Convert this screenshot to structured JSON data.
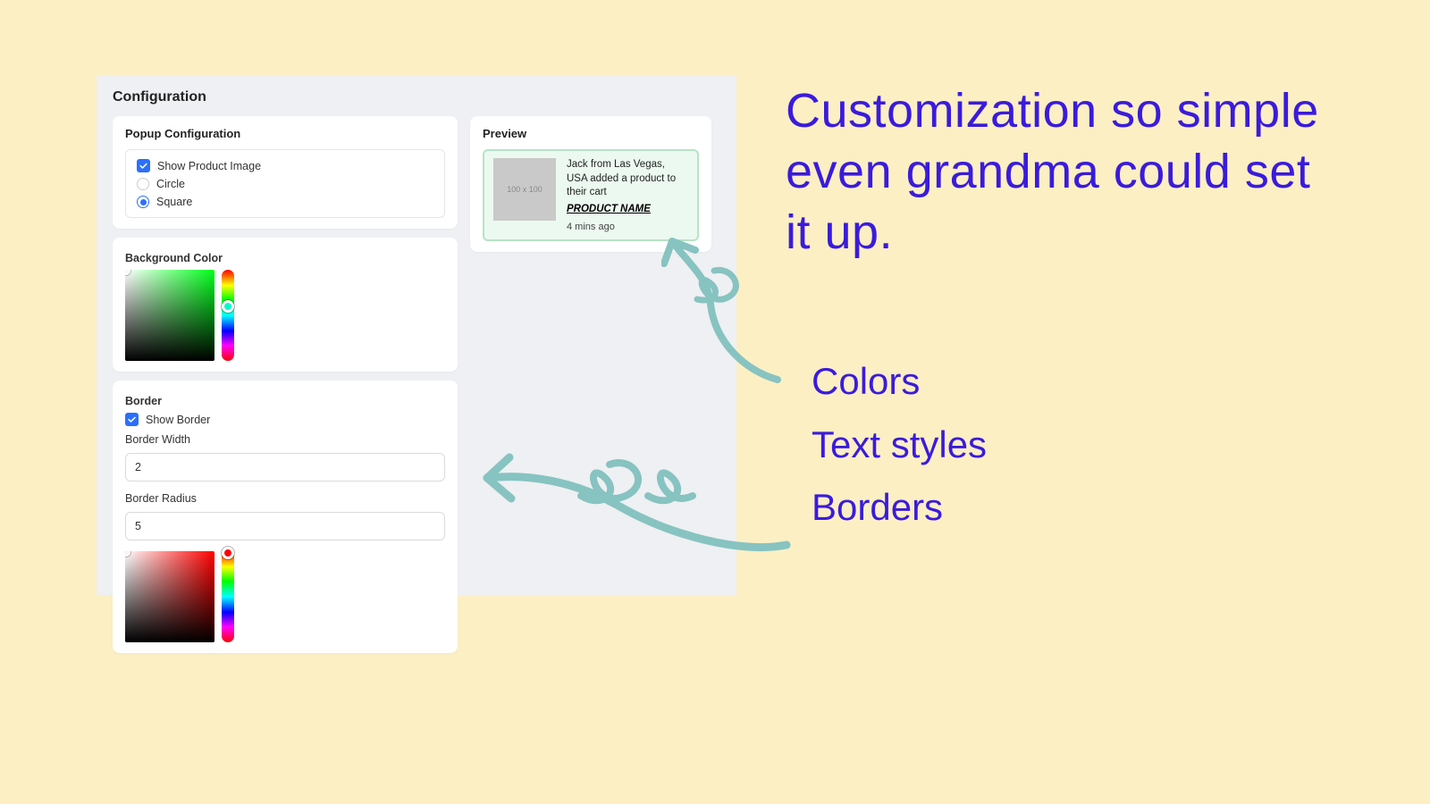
{
  "page": {
    "title": "Configuration"
  },
  "popup": {
    "title": "Popup Configuration",
    "showImage": {
      "label": "Show Product Image",
      "checked": true
    },
    "shape": {
      "circle": {
        "label": "Circle",
        "selected": false
      },
      "square": {
        "label": "Square",
        "selected": true
      }
    }
  },
  "bg": {
    "title": "Background Color",
    "hue_hex": "#00ff1a",
    "hue_pos_pct": 40
  },
  "border": {
    "title": "Border",
    "showBorder": {
      "label": "Show Border",
      "checked": true
    },
    "widthLabel": "Border Width",
    "widthValue": "2",
    "radiusLabel": "Border Radius",
    "radiusValue": "5",
    "hue_hex": "#ff0000",
    "hue_pos_pct": 2
  },
  "preview": {
    "title": "Preview",
    "imgLabel": "100 x 100",
    "message": "Jack from Las Vegas, USA added a product to their cart",
    "product": "PRODUCT NAME",
    "time": "4 mins ago"
  },
  "marketing": {
    "tagline": "Customization so simple even grandma could set it up.",
    "bullets": {
      "b1": "Colors",
      "b2": "Text styles",
      "b3": "Borders"
    }
  },
  "colors": {
    "accent_teal": "#87c3c1",
    "brand_blue": "#3a1bdc"
  }
}
